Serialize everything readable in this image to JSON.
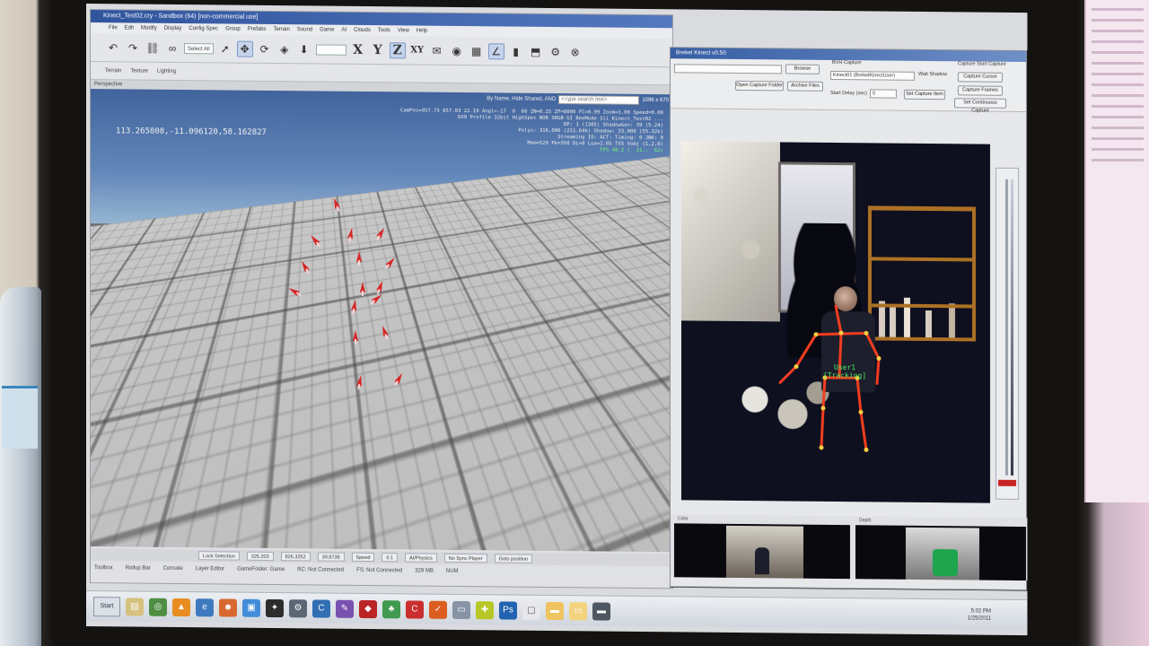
{
  "editor": {
    "title": "Kinect_Test02.cry - Sandbox (64) [non-commercial use]",
    "menu": [
      "File",
      "Edit",
      "Modify",
      "Display",
      "Config Spec",
      "Group",
      "Prefabs",
      "Terrain",
      "Sound",
      "Game",
      "AI",
      "Clouds",
      "Tools",
      "View",
      "Help"
    ],
    "axis_labels": {
      "x": "X",
      "y": "Y",
      "z": "Z",
      "xy": "XY"
    },
    "select_all": "Select All",
    "toolbar2": {
      "terrain": "Terrain",
      "texture": "Texture",
      "lighting": "Lighting"
    },
    "viewport_label": "Perspective",
    "search": {
      "filter_label": "By Name, Hide Shared, AND",
      "placeholder": "<Type search text>",
      "resolution": "1096 x 670"
    },
    "coords": "113.265808,-11.096120,58.162827",
    "stats": [
      "CamPos=957.73 857.03 22.19 Angl=-17  0  60 ZN=0.25 ZF=8000 FC=0.99 Zoom=1.00 Speed=0.00",
      "DX9 Profile 32bit HighSpec NOR SRGB GI BeeMode Sli Kinect_Test02 ...",
      "DP: 1 (1305) ShadowGen: 39 (5.24)",
      "Polys: 316,006 (211.64k) Shadow: 33,000 (55.32k)",
      "Streaming IO: ACT: Timing: 0 JNK: 0",
      "Mem=529 Pk=350 DL=0 Lua=1.05 TVS Vobj (1,2,0)"
    ],
    "fps": "FPS 48.2 (  21..  62)",
    "statusbar": [
      "Lock Selection",
      "325.203",
      "826.3252",
      "39.8738",
      "Speed",
      "0.1",
      "AI/Physics",
      "No Sync Player",
      "Goto position"
    ],
    "bottom_tabs": [
      "Toolbox",
      "Rollup Bar",
      "Console",
      "Layer Editor",
      "GameFolder: Game",
      "RC: Not Connected",
      "FS: Not Connected",
      "329 MB",
      "NUM"
    ]
  },
  "kinect": {
    "title": "Brekel Kinect v0.50",
    "buttons": [
      "Browse",
      "Open Capture Folder",
      "Archive Files",
      "Capture Cursor",
      "Capture Frames",
      "Set Continuous Capture"
    ],
    "labels": [
      "BVH Capture",
      "Capture Start Capture",
      "Start Delay (sec)",
      "Wait Shadow",
      "Set Capture Item",
      "Recording",
      "Rec Skeleton"
    ],
    "input_value": "Kinect01 (BrekelKinectUser)",
    "delay_value": "0",
    "user_label": "User1",
    "tracking_label": "[Tracking]",
    "thumb_labels": [
      "Color",
      "Depth"
    ],
    "accent": "#d02020",
    "skeleton_color": "#ff3a1a"
  },
  "taskbar": {
    "start": "Start",
    "icons": [
      "explorer-icon",
      "folder-icon",
      "chrome-icon",
      "vlc-icon",
      "firefox-icon",
      "ie-icon",
      "app-icon",
      "photoshop-icon"
    ],
    "time": "5:02 PM",
    "date": "1/25/2011"
  }
}
